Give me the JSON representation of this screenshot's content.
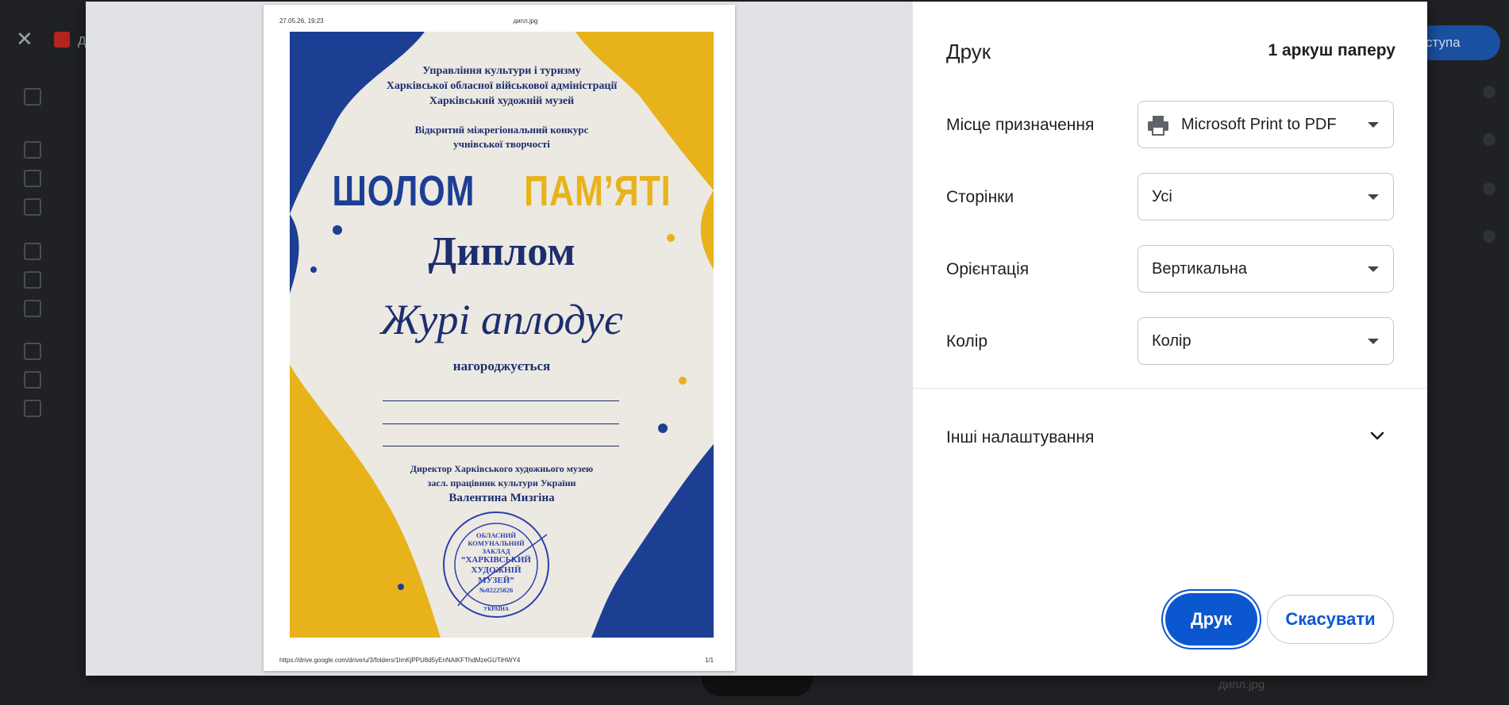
{
  "background_app": {
    "file_name_fragment": "д",
    "share_button_fragment": "ступа",
    "bottom_item": "дипл.jpg"
  },
  "print_preview": {
    "header_datetime": "27.05.26, 19:23",
    "header_title": "дипл.jpg",
    "footer_url": "https://drive.google.com/drive/u/3/folders/1lmKjPPU8d5yEnNAlKFThdMzeGUTiHWY4",
    "footer_page": "1/1",
    "diploma": {
      "org_line1": "Управління культури і туризму",
      "org_line2": "Харківської обласної військової адміністрації",
      "org_line3": "Харківський художній музей",
      "contest_line1": "Відкритий міжрегіональний конкурс",
      "contest_line2": "учнівської творчості",
      "event_part1": "ШОЛОМ",
      "event_part2": "ПАМ’ЯТІ",
      "heading": "Диплом",
      "award": "Журі аплодує",
      "awarded": "нагороджується",
      "signer_line1": "Директор Харківського художнього музею",
      "signer_line2": "засл. працівник культури України",
      "signer_name": "Валентина Мизгіна",
      "stamp_line1": "ОБЛАСНИЙ",
      "stamp_line2": "КОМУНАЛЬНИЙ",
      "stamp_line3": "ЗАКЛАД",
      "stamp_line4": "“ХАРКІВСЬКИЙ",
      "stamp_line5": "ХУДОЖНІЙ",
      "stamp_line6": "МУЗЕЙ”",
      "stamp_line7": "№02225826",
      "stamp_ring_bottom": "УКРАЇНА",
      "colors": {
        "blue": "#1c3f94",
        "yellow": "#e8b21a"
      }
    }
  },
  "settings": {
    "title": "Друк",
    "sheets": "1 аркуш паперу",
    "destination": {
      "label": "Місце призначення",
      "value": "Microsoft Print to PDF",
      "icon": "printer-icon"
    },
    "pages": {
      "label": "Сторінки",
      "value": "Усі"
    },
    "orientation": {
      "label": "Орієнтація",
      "value": "Вертикальна"
    },
    "color": {
      "label": "Колір",
      "value": "Колір"
    },
    "more_settings": "Інші налаштування",
    "print_button": "Друк",
    "cancel_button": "Скасувати",
    "accent": "#0b57d0"
  }
}
